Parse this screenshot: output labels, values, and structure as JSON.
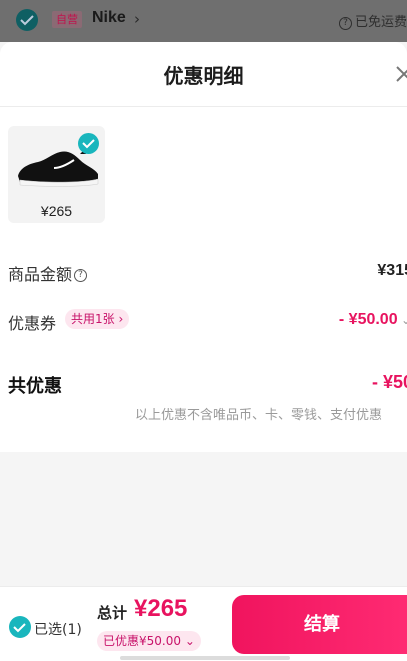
{
  "background_header": {
    "tag": "自营",
    "brand": "Nike",
    "shipping_text": "已免运费"
  },
  "modal": {
    "title": "优惠明细"
  },
  "product": {
    "price": "¥265"
  },
  "rows": {
    "goods_amount_label": "商品金额",
    "goods_amount_value": "¥315",
    "coupon_label": "优惠券",
    "coupon_tag": "共用1张",
    "coupon_value": "- ¥50.00",
    "total_discount_label": "共优惠",
    "total_discount_value": "- ¥50"
  },
  "note": "以上优惠不含唯品币、卡、零钱、支付优惠",
  "bottom_bar": {
    "selected": "已选(1)",
    "total_label": "总计",
    "total_value": "¥265",
    "discount_pill": "已优惠¥50.00",
    "checkout": "结算"
  },
  "colors": {
    "accent": "#e8135f",
    "check": "#19b6bd",
    "pill_bg": "#fde6ef"
  }
}
